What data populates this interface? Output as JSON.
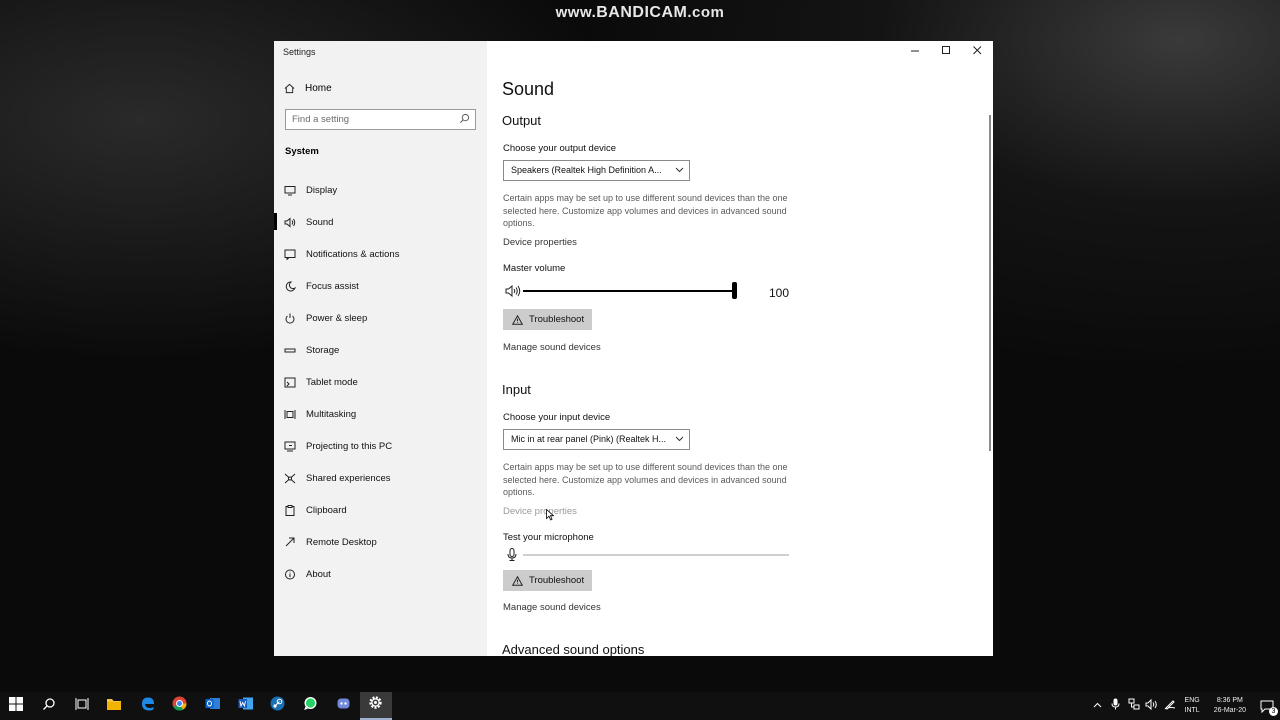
{
  "watermark": {
    "prefix": "www.",
    "brand": "BANDICAM",
    "suffix": ".com"
  },
  "window": {
    "title": "Settings"
  },
  "sidebar": {
    "home": "Home",
    "search_placeholder": "Find a setting",
    "section": "System",
    "items": [
      {
        "label": "Display",
        "icon": "display-icon"
      },
      {
        "label": "Sound",
        "icon": "speaker-icon",
        "selected": true
      },
      {
        "label": "Notifications & actions",
        "icon": "notifications-icon"
      },
      {
        "label": "Focus assist",
        "icon": "moon-icon"
      },
      {
        "label": "Power & sleep",
        "icon": "power-icon"
      },
      {
        "label": "Storage",
        "icon": "storage-icon"
      },
      {
        "label": "Tablet mode",
        "icon": "tablet-icon"
      },
      {
        "label": "Multitasking",
        "icon": "multitasking-icon"
      },
      {
        "label": "Projecting to this PC",
        "icon": "projecting-icon"
      },
      {
        "label": "Shared experiences",
        "icon": "shared-icon"
      },
      {
        "label": "Clipboard",
        "icon": "clipboard-icon"
      },
      {
        "label": "Remote Desktop",
        "icon": "remote-desktop-icon"
      },
      {
        "label": "About",
        "icon": "info-icon"
      }
    ]
  },
  "content": {
    "title": "Sound",
    "output": {
      "heading": "Output",
      "choose_label": "Choose your output device",
      "device": "Speakers (Realtek High Definition A...",
      "desc": "Certain apps may be set up to use different sound devices than the one selected here. Customize app volumes and devices in advanced sound options.",
      "device_properties": "Device properties",
      "master_volume_label": "Master volume",
      "master_volume": 100,
      "troubleshoot": "Troubleshoot",
      "manage": "Manage sound devices"
    },
    "input": {
      "heading": "Input",
      "choose_label": "Choose your input device",
      "device": "Mic in at rear panel (Pink) (Realtek H...",
      "desc": "Certain apps may be set up to use different sound devices than the one selected here. Customize app volumes and devices in advanced sound options.",
      "device_properties": "Device properties",
      "test_label": "Test your microphone",
      "mic_level": 0,
      "troubleshoot": "Troubleshoot",
      "manage": "Manage sound devices"
    },
    "advanced_heading": "Advanced sound options"
  },
  "taskbar": {
    "apps": [
      "start-icon",
      "search-icon",
      "task-view-icon",
      "file-explorer-icon",
      "edge-icon",
      "chrome-icon",
      "outlook-icon",
      "word-icon",
      "steam-icon",
      "whatsapp-icon",
      "discord-icon",
      "settings-icon"
    ],
    "lang_1": "ENG",
    "lang_2": "INTL",
    "time": "8:36 PM",
    "date": "26-Mar-20",
    "notification_count": "3"
  },
  "colors": {
    "accent": "#000000",
    "sidebar_bg": "#f2f2f2",
    "button_bg": "#cccccc",
    "taskbar_bg": "#101010"
  }
}
